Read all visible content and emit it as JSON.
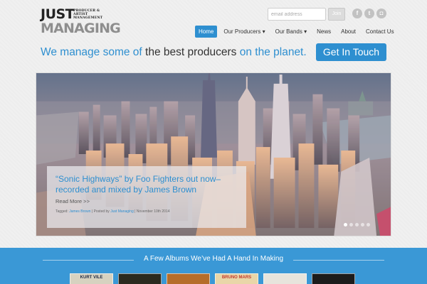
{
  "brand": {
    "line1": "JUST",
    "sub": "PRODUCER & ARTIST MANAGEMENT",
    "line2": "MANAGING"
  },
  "signup": {
    "placeholder": "email address",
    "button": "Join"
  },
  "social": [
    "f",
    "t",
    "◘"
  ],
  "nav": [
    {
      "label": "Home",
      "active": true
    },
    {
      "label": "Our Producers ▾"
    },
    {
      "label": "Our Bands ▾"
    },
    {
      "label": "News"
    },
    {
      "label": "About"
    },
    {
      "label": "Contact Us"
    }
  ],
  "tagline": {
    "part1": "We manage some of",
    "part2": " the best producers ",
    "part3": "on the planet."
  },
  "cta": "Get In Touch",
  "hero": {
    "title": "“Sonic Highways” by Foo Fighters out now– recorded and mixed by James Brown",
    "read_more": "Read More >>",
    "meta_tagged": "Tagged:",
    "meta_tag": "James Brown",
    "meta_posted": "| Posted by",
    "meta_author": "Just Managing",
    "meta_date": "| November 10th 2014"
  },
  "albums": {
    "heading": "A Few Albums We’ve Had A Hand In Making",
    "covers": [
      {
        "text": "KURT VILE",
        "bg": "#d7d2c0",
        "fg": "#1e2a44"
      },
      {
        "text": "",
        "bg": "#2b2a1f",
        "fg": "#c9a85a"
      },
      {
        "text": "",
        "bg": "#b66d2a",
        "fg": "#f1dcb0"
      },
      {
        "text": "BRUNO MARS",
        "bg": "#e9d6a8",
        "fg": "#c43a2d"
      },
      {
        "text": "",
        "bg": "#e7e4dc",
        "fg": "#333"
      },
      {
        "text": "",
        "bg": "#1c1c1c",
        "fg": "#ddd"
      }
    ]
  }
}
